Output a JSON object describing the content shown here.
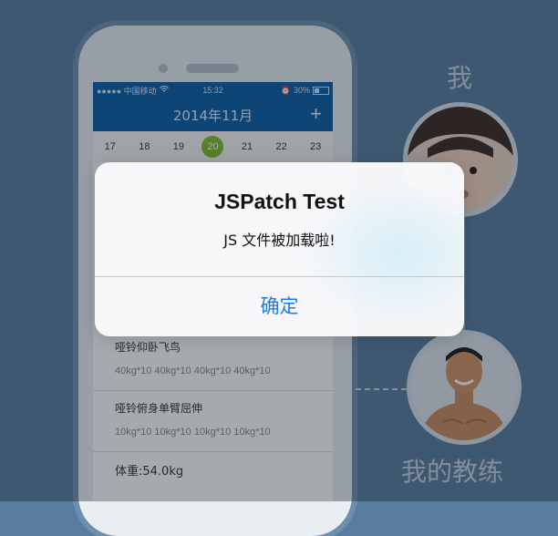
{
  "status_bar": {
    "signal": "●●●●● 中国移动",
    "time": "15:32",
    "battery_text": "30%"
  },
  "nav": {
    "title": "2014年11月",
    "add_label": "+"
  },
  "days": [
    {
      "label": "17",
      "active": false
    },
    {
      "label": "18",
      "active": false
    },
    {
      "label": "19",
      "active": false
    },
    {
      "label": "20",
      "active": true
    },
    {
      "label": "21",
      "active": false
    },
    {
      "label": "22",
      "active": false
    },
    {
      "label": "23",
      "active": false
    }
  ],
  "workouts": [
    {
      "title": "哑铃仰卧飞鸟",
      "sets": "40kg*10 40kg*10 40kg*10 40kg*10"
    },
    {
      "title": "哑铃俯身单臂屈伸",
      "sets": "10kg*10 10kg*10 10kg*10 10kg*10"
    }
  ],
  "weight": "体重:54.0kg",
  "side": {
    "me_label": "我",
    "coach_label": "我的教练"
  },
  "alert": {
    "title": "JSPatch Test",
    "message": "JS 文件被加载啦!",
    "confirm_label": "确定"
  },
  "colors": {
    "accent": "#1a7de6",
    "nav_blue": "#0a5ea8",
    "day_active": "#7dbf29"
  }
}
